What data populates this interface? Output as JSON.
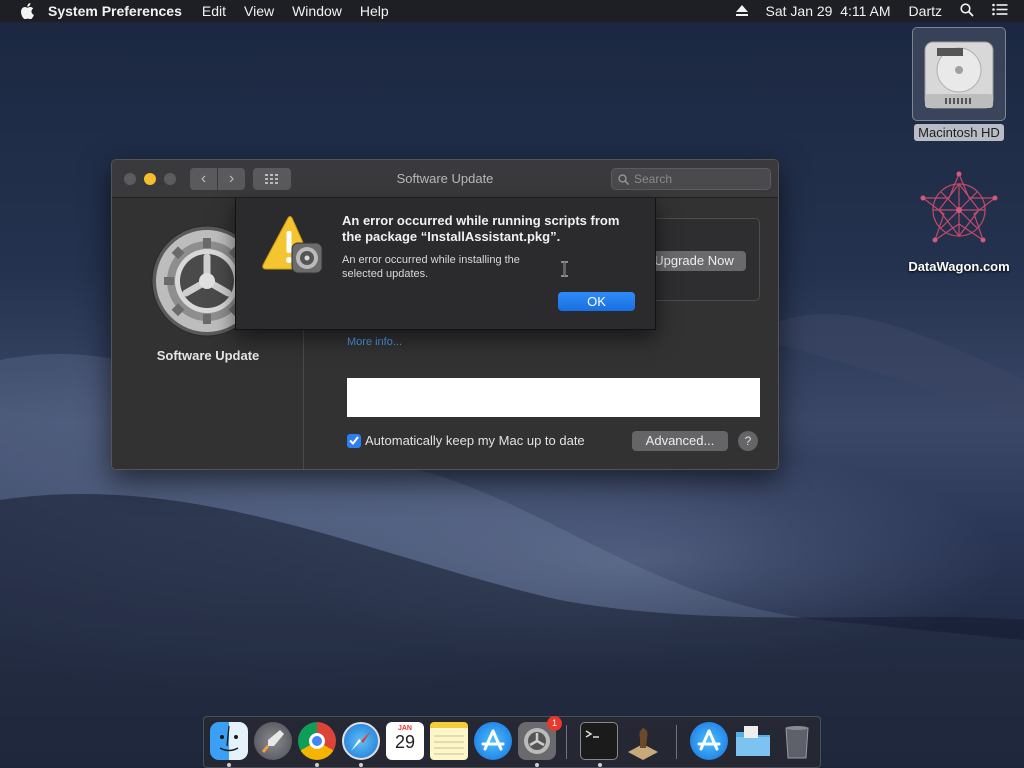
{
  "menubar": {
    "app_name": "System Preferences",
    "menus": [
      "Edit",
      "View",
      "Window",
      "Help"
    ],
    "clock": "Sat Jan 29  4:11 AM",
    "user": "Dartz"
  },
  "desktop": {
    "icons": [
      {
        "label": "Macintosh HD",
        "icon": "hard-drive-icon"
      },
      {
        "label": "DataWagon.com",
        "icon": "network-sphere-icon"
      }
    ]
  },
  "window": {
    "title": "Software Update",
    "search_placeholder": "Search",
    "sidebar_title": "Software Update",
    "upgrade_button": "Upgrade Now",
    "more_info": "More info...",
    "auto_update_label": "Automatically keep my Mac up to date",
    "auto_update_checked": true,
    "advanced_button": "Advanced...",
    "help_button": "?"
  },
  "alert": {
    "title": "An error occurred while running scripts from the package “InstallAssistant.pkg”.",
    "message": "An error occurred while installing the selected updates.",
    "ok_button": "OK",
    "icon": "warning-icon"
  },
  "dock": {
    "calendar_month": "JAN",
    "calendar_day": "29",
    "badge_count": "1",
    "items": [
      "finder-icon",
      "launchpad-icon",
      "chrome-icon",
      "safari-icon",
      "calendar-icon",
      "notes-icon",
      "app-store-icon",
      "system-preferences-icon",
      "terminal-icon",
      "chess-icon",
      "app-store-folder-icon",
      "folder-icon",
      "trash-icon"
    ]
  },
  "colors": {
    "accent": "#2c7ef2",
    "window_bg": "#323233",
    "alert_bg": "#2b2b2d"
  }
}
